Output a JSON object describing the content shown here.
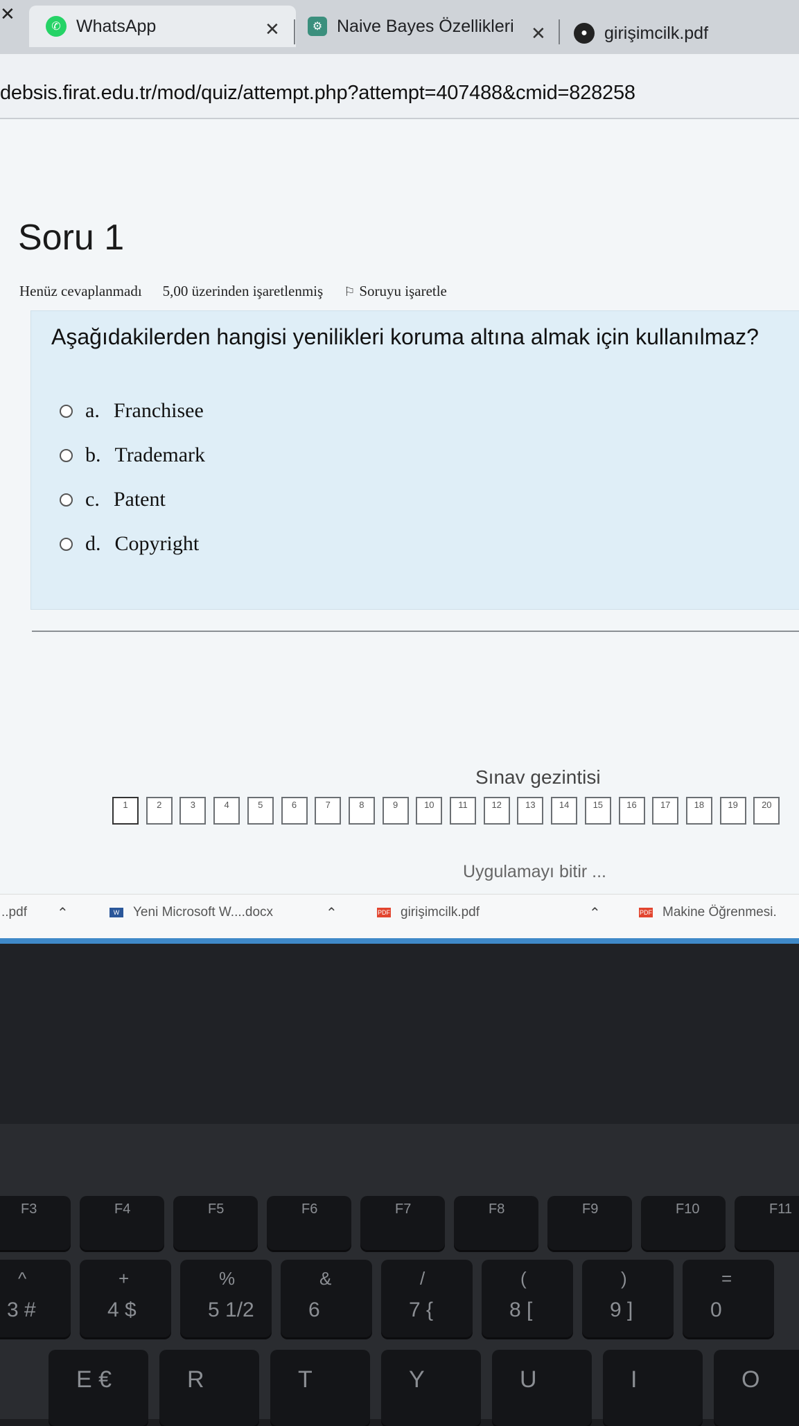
{
  "browser": {
    "tabs": [
      {
        "title": "WhatsApp"
      },
      {
        "title": "Naive Bayes Özellikleri"
      },
      {
        "title": "girişimcilk.pdf"
      }
    ],
    "url": "debsis.firat.edu.tr/mod/quiz/attempt.php?attempt=407488&cmid=828258"
  },
  "quiz": {
    "question_title": "Soru 1",
    "status": "Henüz cevaplanmadı",
    "marks": "5,00 üzerinden işaretlenmiş",
    "flag_label": "Soruyu işaretle",
    "question_text": "Aşağıdakilerden hangisi yenilikleri koruma altına almak için kullanılmaz?",
    "options": [
      {
        "letter": "a.",
        "text": "Franchisee"
      },
      {
        "letter": "b.",
        "text": "Trademark"
      },
      {
        "letter": "c.",
        "text": "Patent"
      },
      {
        "letter": "d.",
        "text": "Copyright"
      }
    ],
    "nav_title": "Sınav gezintisi",
    "nav_numbers": [
      "1",
      "2",
      "3",
      "4",
      "5",
      "6",
      "7",
      "8",
      "9",
      "10",
      "11",
      "12",
      "13",
      "14",
      "15",
      "16",
      "17",
      "18",
      "19",
      "20"
    ],
    "finish_label": "Uygulamayı bitir ..."
  },
  "downloads": [
    {
      "name": "..pdf"
    },
    {
      "name": "Yeni Microsoft W....docx",
      "type": "W"
    },
    {
      "name": "girişimcilk.pdf",
      "type": "PDF"
    },
    {
      "name": "Makine Öğrenmesi.",
      "type": "PDF"
    }
  ],
  "keyboard": {
    "fn_keys": [
      "F3",
      "F4",
      "F5",
      "F6",
      "F7",
      "F8",
      "F9",
      "F10",
      "F11"
    ],
    "num_keys": [
      {
        "top": "^",
        "bottom": "3 #"
      },
      {
        "top": "+",
        "bottom": "4 $"
      },
      {
        "top": "%",
        "bottom": "5 1/2"
      },
      {
        "top": "&",
        "bottom": "6"
      },
      {
        "top": "/",
        "bottom": "7 {"
      },
      {
        "top": "(",
        "bottom": "8 ["
      },
      {
        "top": ")",
        "bottom": "9 ]"
      },
      {
        "top": "=",
        "bottom": "0"
      }
    ],
    "letter_keys": [
      "E €",
      "R",
      "T",
      "Y",
      "U",
      "I",
      "O"
    ]
  },
  "colors": {
    "whatsapp": "#25d366",
    "pdf_red": "#e2452f",
    "word_blue": "#2b579a",
    "question_bg": "#dfeef7",
    "taskbar": "#3f89c8"
  }
}
